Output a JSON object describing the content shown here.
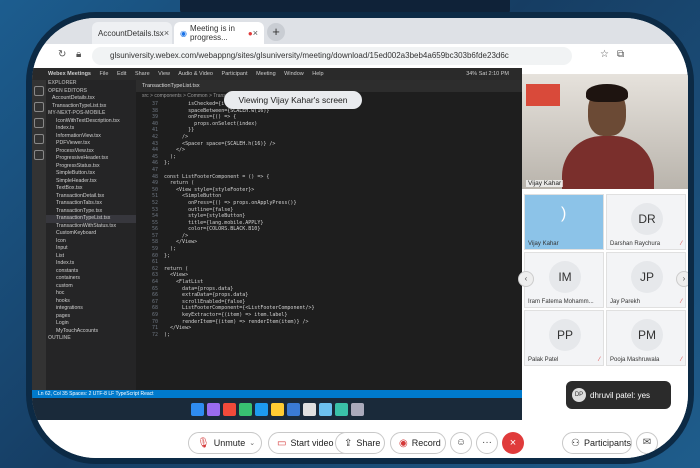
{
  "browser": {
    "tabs": [
      {
        "label": "AccountDetails.tsx"
      },
      {
        "label": "Meeting is in progress..."
      }
    ],
    "url": "glsuniversity.webex.com/webappng/sites/glsuniversity/meeting/download/15ed002a3beb4a659bc303b6fde23d6c"
  },
  "shared_screen": {
    "viewing_label": "Viewing Vijay Kahar's screen",
    "app_menu": [
      "Webex Meetings",
      "File",
      "Edit",
      "Share",
      "View",
      "Audio & Video",
      "Participant",
      "Meeting",
      "Window",
      "Help"
    ],
    "sys_status": "34% Sat 2:10 PM",
    "editor_tab": "TransactionTypeList.tsx",
    "breadcrumb": "src > components > Common > TransactionTypeList.tsx",
    "explorer": {
      "items": [
        "EXPLORER",
        "OPEN EDITORS",
        "AccountDetails.tsx",
        "TransactionTypeList.tsx",
        "MY-NEXT-POS-MOBILE",
        "IconWithTextDescription.tsx",
        "Index.ts",
        "InformationView.tsx",
        "PDFViewer.tsx",
        "ProcessView.tsx",
        "ProgressiveHeader.tsx",
        "ProgressStatus.tsx",
        "SimpleButton.tsx",
        "SimpleHeader.tsx",
        "TextBox.tsx",
        "TransactionDetail.tsx",
        "TransactionTabs.tsx",
        "TransactionType.tsx",
        "TransactionTypeList.tsx",
        "TransactionWithStatus.tsx",
        "CustomKeyboard",
        "Icon",
        "Input",
        "List",
        "Index.ts",
        "constants",
        "containers",
        "custom",
        "hoc",
        "hooks",
        "integrations",
        "pages",
        "Login",
        "MyTouchAccounts",
        "OUTLINE"
      ]
    },
    "code_lines": [
      {
        "n": "37",
        "text": "        isChecked={item.value}"
      },
      {
        "n": "38",
        "text": "        spaceBetween={SCALEH.w(16)}"
      },
      {
        "n": "39",
        "text": "        onPress={() => {"
      },
      {
        "n": "40",
        "text": "          props.onSelect(index)"
      },
      {
        "n": "41",
        "text": "        }}"
      },
      {
        "n": "42",
        "text": "      />"
      },
      {
        "n": "43",
        "text": "      <Spacer space={SCALEH.h(16)} />"
      },
      {
        "n": "44",
        "text": "    </>"
      },
      {
        "n": "45",
        "text": "  );"
      },
      {
        "n": "46",
        "text": "};"
      },
      {
        "n": "47",
        "text": ""
      },
      {
        "n": "48",
        "text": "const ListFooterComponent = () => {"
      },
      {
        "n": "49",
        "text": "  return ("
      },
      {
        "n": "50",
        "text": "    <View style={styleFooter}>"
      },
      {
        "n": "51",
        "text": "      <SimpleButton"
      },
      {
        "n": "52",
        "text": "        onPress={() => props.onApplyPress()}"
      },
      {
        "n": "53",
        "text": "        outline={false}"
      },
      {
        "n": "54",
        "text": "        style={styleButton}"
      },
      {
        "n": "55",
        "text": "        title={lang.mobile.APPLY}"
      },
      {
        "n": "56",
        "text": "        color={COLORS.BLACK.B10}"
      },
      {
        "n": "57",
        "text": "      />"
      },
      {
        "n": "58",
        "text": "    </View>"
      },
      {
        "n": "59",
        "text": "  );"
      },
      {
        "n": "60",
        "text": "};"
      },
      {
        "n": "61",
        "text": ""
      },
      {
        "n": "62",
        "text": "return ("
      },
      {
        "n": "63",
        "text": "  <View>"
      },
      {
        "n": "64",
        "text": "    <FlatList"
      },
      {
        "n": "65",
        "text": "      data={props.data}"
      },
      {
        "n": "66",
        "text": "      extraData={props.data}"
      },
      {
        "n": "67",
        "text": "      scrollEnabled={false}"
      },
      {
        "n": "68",
        "text": "      ListFooterComponent={<ListFooterComponent/>}"
      },
      {
        "n": "69",
        "text": "      keyExtractor={(item) => item.label}"
      },
      {
        "n": "70",
        "text": "      renderItem={(item) => renderItem(item)} />"
      },
      {
        "n": "71",
        "text": "  </View>"
      },
      {
        "n": "72",
        "text": ");"
      }
    ],
    "status_bar": "Ln 62, Col 35   Spaces: 2   UTF-8   LF   TypeScript React"
  },
  "participants": {
    "main_video_name": "Vijay Kahar",
    "tiles": [
      {
        "initials": "",
        "name": "Vijay Kahar",
        "muted": false,
        "speaking": true
      },
      {
        "initials": "DR",
        "name": "Darshan Raychura",
        "muted": true
      },
      {
        "initials": "IM",
        "name": "Iram Fatema Mohamm...",
        "muted": false
      },
      {
        "initials": "JP",
        "name": "Jay Parekh",
        "muted": true
      },
      {
        "initials": "PP",
        "name": "Palak Patel",
        "muted": true
      },
      {
        "initials": "PM",
        "name": "Pooja Mashruwala",
        "muted": true
      }
    ]
  },
  "chat_toast": {
    "avatar": "DP",
    "text": "dhruvil patel: yes"
  },
  "controls": {
    "unmute": "Unmute",
    "start_video": "Start video",
    "share": "Share",
    "record": "Record",
    "participants": "Participants"
  }
}
